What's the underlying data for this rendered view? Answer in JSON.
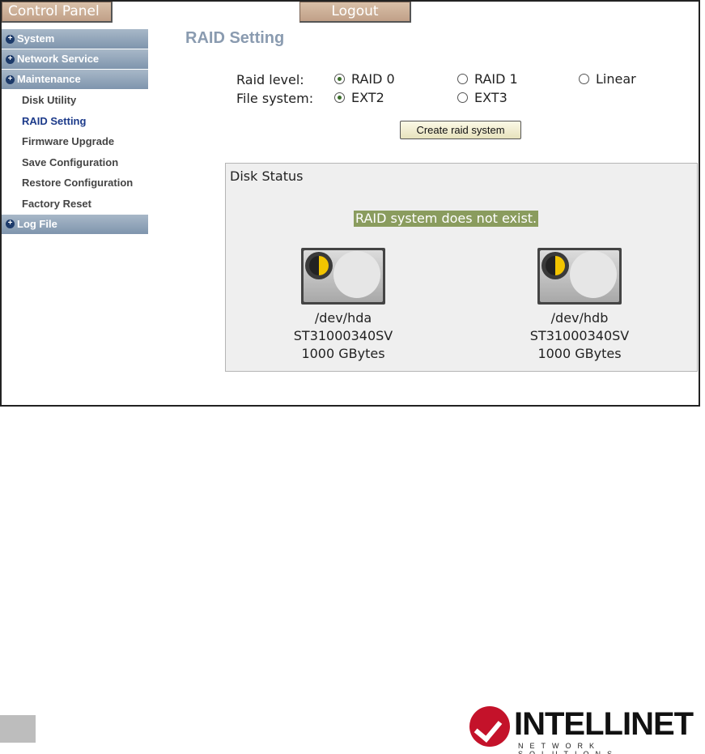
{
  "header": {
    "control_panel_label": "Control Panel",
    "logout_label": "Logout"
  },
  "sidebar": {
    "sections": [
      {
        "label": "System"
      },
      {
        "label": "Network Service"
      },
      {
        "label": "Maintenance"
      }
    ],
    "maintenance_items": [
      {
        "label": "Disk Utility"
      },
      {
        "label": "RAID Setting",
        "active": true
      },
      {
        "label": "Firmware Upgrade"
      },
      {
        "label": "Save Configuration"
      },
      {
        "label": "Restore Configuration"
      },
      {
        "label": "Factory Reset"
      }
    ],
    "log_file_label": "Log File"
  },
  "main": {
    "title": "RAID Setting",
    "raid_level_label": "Raid level:",
    "raid_options": [
      {
        "label": "RAID 0",
        "selected": true
      },
      {
        "label": "RAID 1",
        "selected": false
      },
      {
        "label": "Linear",
        "selected": false
      }
    ],
    "file_system_label": "File system:",
    "fs_options": [
      {
        "label": "EXT2",
        "selected": true
      },
      {
        "label": "EXT3",
        "selected": false
      }
    ],
    "create_button_label": "Create raid system"
  },
  "disk_status": {
    "title": "Disk Status",
    "message": "RAID system does not exist.",
    "disks": [
      {
        "device": "/dev/hda",
        "model": "ST31000340SV",
        "size": "1000 GBytes"
      },
      {
        "device": "/dev/hdb",
        "model": "ST31000340SV",
        "size": "1000 GBytes"
      }
    ]
  },
  "footer": {
    "brand": "INTELLINET",
    "brand_sub": "NETWORK SOLUTIONS"
  },
  "colors": {
    "tab_bg": "#c8a890",
    "sidebar_head": "#8a9db3",
    "active_item": "#1c3a8a",
    "status_msg_bg": "#8a9c5e",
    "brand_red": "#c4122a"
  }
}
